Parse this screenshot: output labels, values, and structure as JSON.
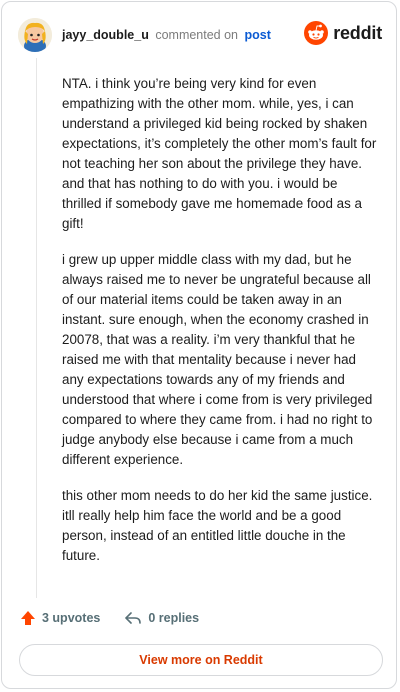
{
  "header": {
    "username": "jayy_double_u",
    "action_text": "commented on",
    "post_link": "post",
    "brand": "reddit"
  },
  "comment": {
    "paragraphs": [
      "NTA. i think you’re being very kind for even empathizing with the other mom. while, yes, i can understand a privileged kid being rocked by shaken expectations, it’s completely the other mom’s fault for not teaching her son about the privilege they have. and that has nothing to do with you. i would be thrilled if somebody gave me homemade food as a gift!",
      "i grew up upper middle class with my dad, but he always raised me to never be ungrateful because all of our material items could be taken away in an instant. sure enough, when the economy crashed in 20078, that was a reality. i’m very thankful that he raised me with that mentality because i never had any expectations towards any of my friends and understood that where i come from is very privileged compared to where they came from. i had no right to judge anybody else because i came from a much different experience.",
      "this other mom needs to do her kid the same justice. itll really help him face the world and be a good person, instead of an entitled little douche in the future."
    ]
  },
  "actions": {
    "upvotes": "3 upvotes",
    "replies": "0 replies"
  },
  "footer": {
    "view_more": "View more on Reddit"
  },
  "colors": {
    "brand_orange": "#ff4500",
    "link_blue": "#0b5bd3",
    "cta_text": "#d93a00"
  },
  "icons": {
    "avatar": "snoo-avatar",
    "brand": "reddit-logo-icon",
    "upvote": "upvote-arrow-icon",
    "reply": "reply-arrow-icon"
  }
}
